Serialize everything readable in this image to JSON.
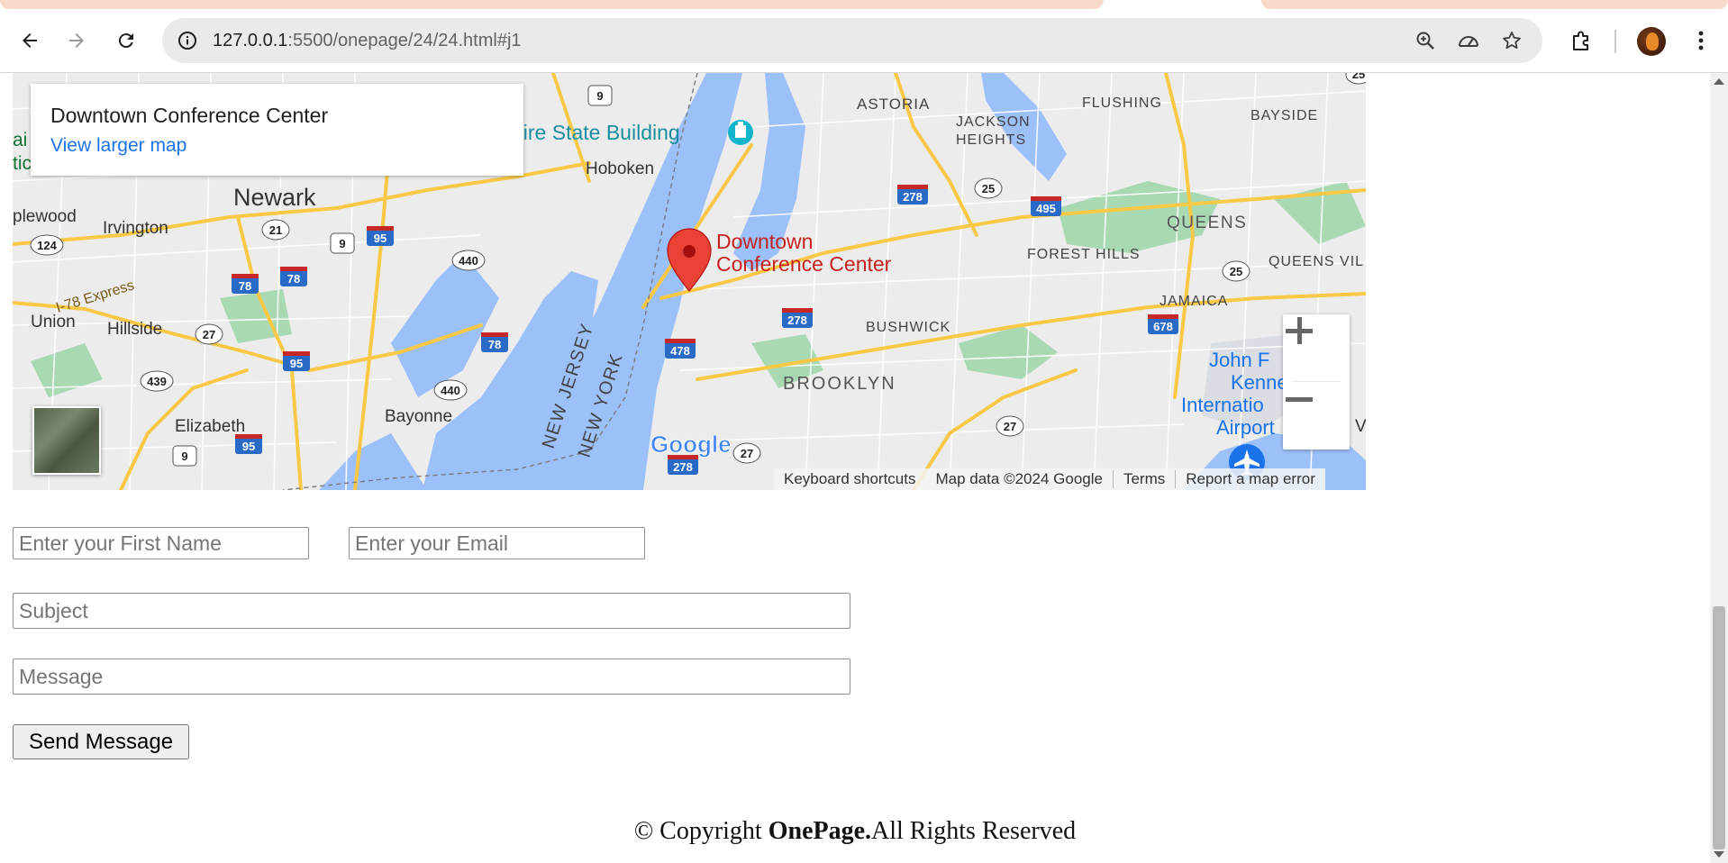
{
  "browser": {
    "url_host": "127.0.0.1",
    "url_rest": ":5500/onepage/24/24.html#j1",
    "icons": [
      "back-arrow-icon",
      "forward-arrow-icon",
      "reload-icon",
      "site-info-icon",
      "zoom-icon",
      "performance-icon",
      "bookmark-star-icon",
      "extensions-icon",
      "profile-avatar",
      "kebab-menu-icon"
    ]
  },
  "map": {
    "place_name": "Downtown Conference Center",
    "view_larger": "View larger map",
    "marker_label_line1": "Downtown",
    "marker_label_line2": "Conference Center",
    "zoom_in": "+",
    "zoom_out": "−",
    "attribution": {
      "shortcuts": "Keyboard shortcuts",
      "data": "Map data ©2024 Google",
      "terms": "Terms",
      "report": "Report a map error"
    },
    "logo": "Google",
    "labels": {
      "astoria": "ASTORIA",
      "flushing": "FLUSHING",
      "bayside": "BAYSIDE",
      "jackson": "JACKSON",
      "heights": "HEIGHTS",
      "empire": "pire State Building",
      "hoboken": "Hoboken",
      "newark": "Newark",
      "irvington": "Irvington",
      "plewood": "plewood",
      "queens": "QUEENS",
      "forest_hills": "FOREST HILLS",
      "queens_vil": "QUEENS VIL",
      "jamaica": "JAMAICA",
      "bushwick": "BUSHWICK",
      "brooklyn": "BROOKLYN",
      "union": "Union",
      "hillside": "Hillside",
      "i78": "I-78 Express",
      "elizabeth": "Elizabeth",
      "bayonne": "Bayonne",
      "new_jersey": "NEW JERSEY",
      "new_york": "NEW YORK",
      "jfk1": "John F",
      "jfk2": "Kenned",
      "jfk3": "Internatio",
      "jfk4": "Airport",
      "ai": "ai",
      "tic": "tic",
      "v_edge": "V"
    },
    "shields": [
      "9",
      "278",
      "25",
      "495",
      "21",
      "9",
      "95",
      "124",
      "440",
      "78",
      "78",
      "25",
      "27",
      "278",
      "678",
      "95",
      "478",
      "78",
      "440",
      "439",
      "27",
      "95",
      "9",
      "278",
      "27",
      "25"
    ]
  },
  "form": {
    "first_name_placeholder": "Enter your First Name",
    "email_placeholder": "Enter your Email",
    "subject_placeholder": "Subject",
    "message_placeholder": "Message",
    "send_label": "Send Message"
  },
  "footer": {
    "prefix": "© Copyright ",
    "brand": "OnePage.",
    "suffix": "All Rights Reserved"
  }
}
